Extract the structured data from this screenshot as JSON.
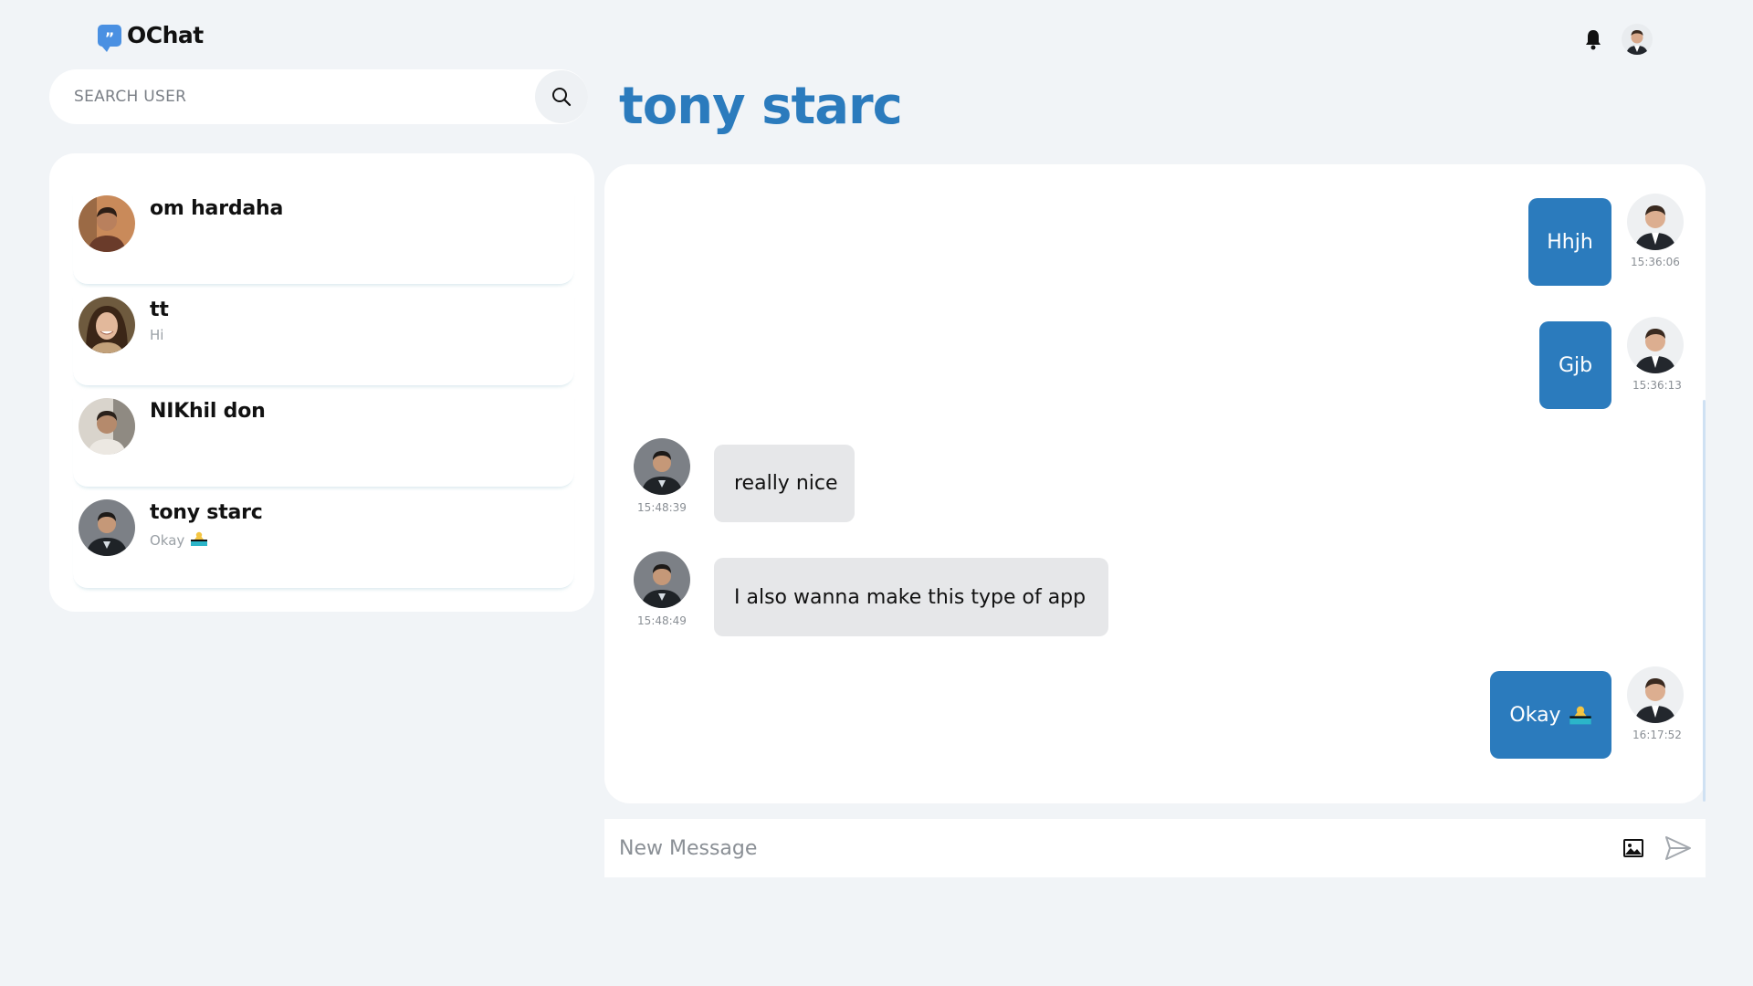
{
  "app": {
    "name": "OChat",
    "logo_glyph": "”"
  },
  "header": {
    "bell_icon": "bell-icon",
    "avatar_icon": "user-avatar"
  },
  "search": {
    "placeholder": "SEARCH USER",
    "icon": "search-icon"
  },
  "users": [
    {
      "name": "om hardaha",
      "last_message": "",
      "avatar_color": "#8a5a3c"
    },
    {
      "name": "tt",
      "last_message": "Hi",
      "avatar_color": "#6b4a30"
    },
    {
      "name": "NIKhil don",
      "last_message": "",
      "avatar_color": "#5e5a55"
    },
    {
      "name": "tony starc",
      "last_message": "Okay",
      "last_message_emoji": "person-bowing-emoji",
      "avatar_color": "#2a2e33"
    }
  ],
  "chat": {
    "title": "tony starc",
    "messages": [
      {
        "direction": "out",
        "text": "Hhjh",
        "time": "15:36:06"
      },
      {
        "direction": "out",
        "text": "Gjb",
        "time": "15:36:13"
      },
      {
        "direction": "in",
        "text": "really nice",
        "time": "15:48:39"
      },
      {
        "direction": "in",
        "text": "I also wanna make this type of app",
        "time": "15:48:49"
      },
      {
        "direction": "out",
        "text": "Okay",
        "emoji": "person-bowing-emoji",
        "time": "16:17:52"
      }
    ]
  },
  "composer": {
    "placeholder": "New Message",
    "image_icon": "image-icon",
    "send_icon": "send-icon"
  },
  "colors": {
    "accent": "#2b7bbd",
    "background": "#f1f4f7",
    "incoming_bubble": "#e6e7e9",
    "logo": "#4a90e2"
  }
}
